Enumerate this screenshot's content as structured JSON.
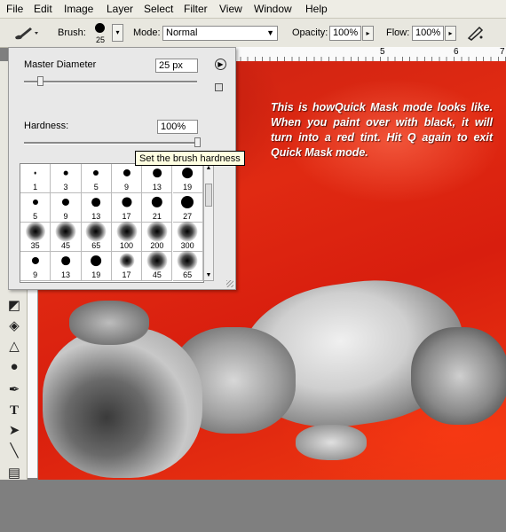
{
  "menu": [
    "File",
    "Edit",
    "Image",
    "Layer",
    "Select",
    "Filter",
    "View",
    "Window",
    "Help"
  ],
  "options": {
    "brush_label": "Brush:",
    "brush_size": "25",
    "mode_label": "Mode:",
    "mode_value": "Normal",
    "opacity_label": "Opacity:",
    "opacity_value": "100%",
    "flow_label": "Flow:",
    "flow_value": "100%"
  },
  "ruler": {
    "marks": [
      "5",
      "6",
      "7"
    ]
  },
  "brush_picker": {
    "master_diameter_label": "Master Diameter",
    "master_diameter_value": "25 px",
    "master_diameter_level": 0.09,
    "hardness_label": "Hardness:",
    "hardness_value": "100%",
    "hardness_level": 1.0,
    "presets": [
      "1",
      "3",
      "5",
      "9",
      "13",
      "19",
      "5",
      "9",
      "13",
      "17",
      "21",
      "27",
      "35",
      "45",
      "65",
      "100",
      "200",
      "300",
      "9",
      "13",
      "19",
      "17",
      "45",
      "65"
    ]
  },
  "tooltip": "Set the brush hardness",
  "caption": "This is howQuick Mask mode looks like. When you paint over with black, it will turn into a red tint. Hit Q again to exit Quick Mask mode.",
  "colors": {
    "mask_red": "#e02a12",
    "tooltip_bg": "#ffffe1",
    "chrome": "#e8e7df"
  }
}
